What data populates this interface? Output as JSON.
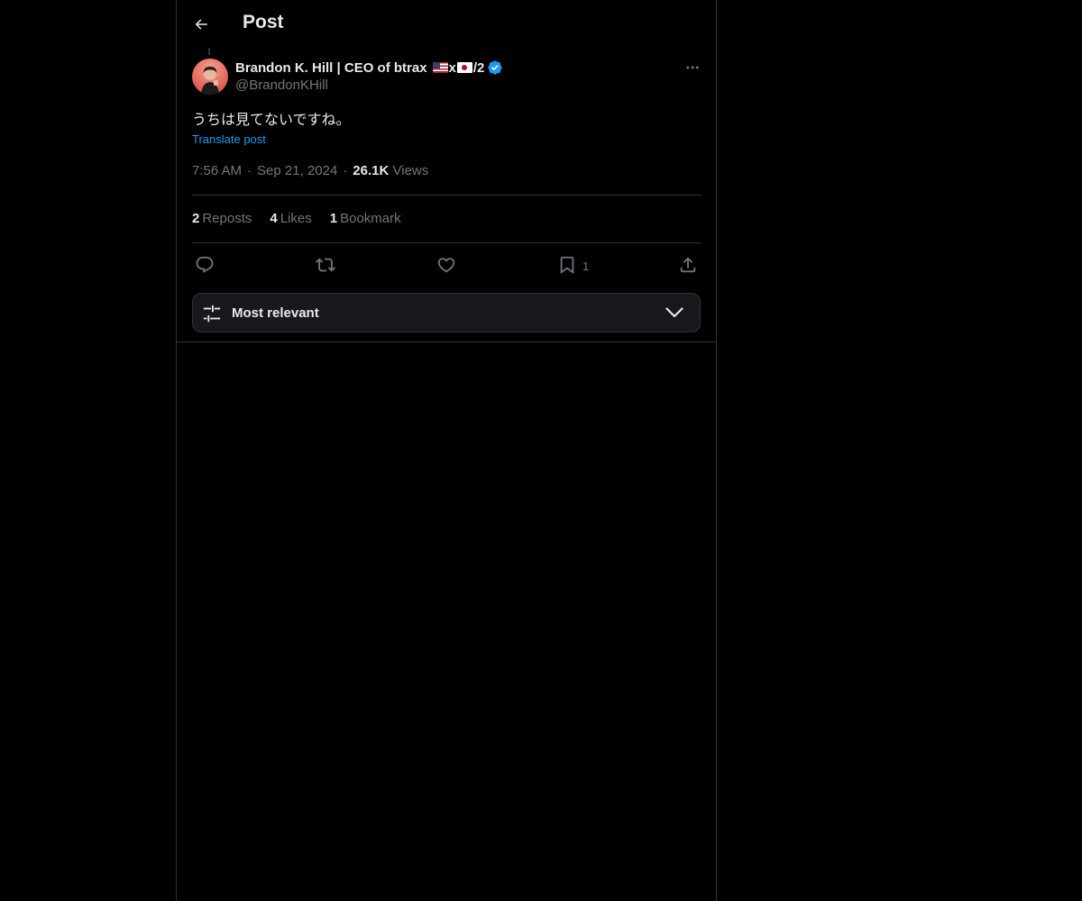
{
  "header": {
    "title": "Post",
    "back_icon": "arrow-left-icon"
  },
  "post": {
    "author": {
      "display_name": "Brandon K. Hill | CEO of btrax",
      "name_flags": [
        "flag-us-icon",
        "flag-jp-icon"
      ],
      "name_x": "x",
      "name_suffix": "/2",
      "verified": true,
      "handle": "@BrandonKHill",
      "avatar_icon": "user-avatar"
    },
    "text": "うちは見てないですね。",
    "translate_label": "Translate post",
    "time": "7:56 AM",
    "date": "Sep 21, 2024",
    "views_count": "26.1K",
    "views_label": "Views",
    "stats": {
      "reposts_count": "2",
      "reposts_label": "Reposts",
      "likes_count": "4",
      "likes_label": "Likes",
      "bookmarks_count": "1",
      "bookmarks_label": "Bookmark"
    },
    "actions": {
      "reply_icon": "reply-icon",
      "repost_icon": "repost-icon",
      "like_icon": "heart-icon",
      "bookmark_icon": "bookmark-icon",
      "bookmark_count": "1",
      "share_icon": "share-icon"
    }
  },
  "replies_sort": {
    "label": "Most relevant",
    "icon": "sliders-icon",
    "chevron": "chevron-down-icon"
  },
  "colors": {
    "background": "#000000",
    "text_primary": "#e7e9ea",
    "text_secondary": "#71767b",
    "accent": "#1d9bf0",
    "border": "#2f3336"
  }
}
